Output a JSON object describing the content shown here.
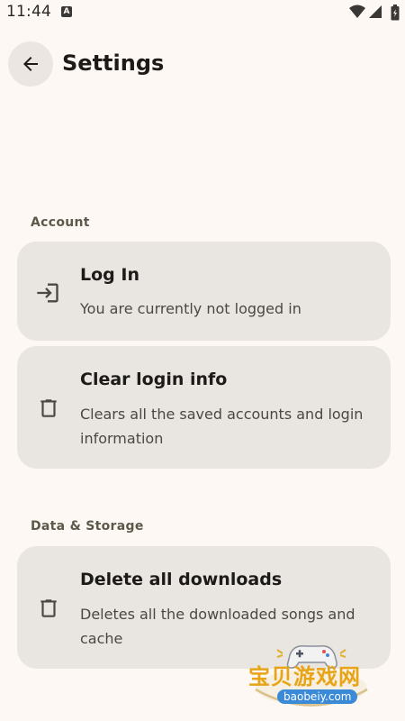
{
  "status_bar": {
    "time": "11:44",
    "notification_icon": "a-badge-icon",
    "icons": [
      "wifi-icon",
      "signal-icon",
      "battery-icon"
    ]
  },
  "header": {
    "back_icon": "arrow-back-icon",
    "title": "Settings"
  },
  "sections": [
    {
      "label": "Account",
      "items": [
        {
          "icon": "login-icon",
          "title": "Log In",
          "subtitle": "You are currently not logged in"
        },
        {
          "icon": "trash-icon",
          "title": "Clear login info",
          "subtitle": "Clears all the saved accounts and login information"
        }
      ]
    },
    {
      "label": "Data & Storage",
      "items": [
        {
          "icon": "trash-icon",
          "title": "Delete all downloads",
          "subtitle": "Deletes all the downloaded songs and cache"
        }
      ]
    }
  ],
  "watermark": {
    "title": "宝贝游戏网",
    "url": "baobeiy.com"
  },
  "colors": {
    "background": "#fdf8f4",
    "card": "#e9e5e0",
    "section_label": "#5b5a4a",
    "text": "#1d1b19"
  }
}
